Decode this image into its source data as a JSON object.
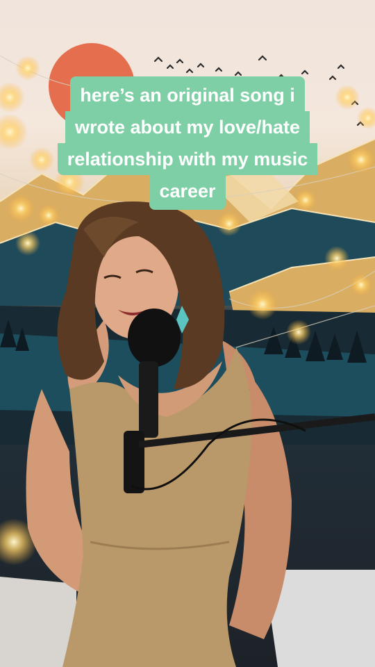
{
  "caption": {
    "lines": [
      "here’s an original song i",
      "wrote about my love/hate",
      "relationship with my music",
      "career"
    ],
    "background_color": "#7ecfa6",
    "text_color": "#ffffff"
  },
  "scene": {
    "sun_color": "#e46e4d",
    "mountain_colors": [
      "#1f4a5a",
      "#d7a85a",
      "#f2d9a8",
      "#15222b"
    ],
    "dress_color": "#b9986a",
    "light_color": "#ffe08a"
  }
}
